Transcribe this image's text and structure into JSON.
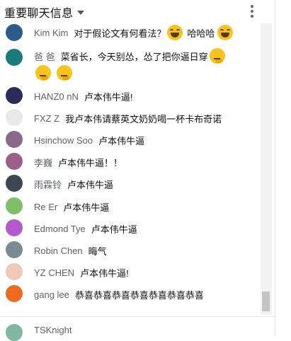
{
  "header": {
    "title": "重要聊天信息"
  },
  "messages": [
    {
      "name": "Kim Kim",
      "text": "对于假论文有何看法？",
      "after": "哈哈哈",
      "avatar_color": "#2b5d8c"
    },
    {
      "name": "爸 爸",
      "text": "菜省长，今天别怂，怂了把你逼日穿",
      "avatar_color": "#1b7a7a"
    },
    {
      "name": "HANZ0 nN",
      "text": "卢本伟牛逼!",
      "avatar_color": "#2a2d5c"
    },
    {
      "name": "FXZ Z",
      "text": "我卢本伟请蔡英文奶奶喝一杯卡布奇诺",
      "avatar_color": "#e9e9e9"
    },
    {
      "name": "Hsinchow Soo",
      "text": "卢本伟牛逼",
      "avatar_color": "#8a6a8a"
    },
    {
      "name": "李巍",
      "text": "卢本伟牛逼！！",
      "avatar_color": "#9c5f88"
    },
    {
      "name": "雨霖铃",
      "text": "卢本伟牛逼",
      "avatar_color": "#3d4651"
    },
    {
      "name": "Re Er",
      "text": "卢本伟牛逼",
      "avatar_color": "#7fbf6a"
    },
    {
      "name": "Edmond Tye",
      "text": "卢本伟牛逼",
      "avatar_color": "#b25acb"
    },
    {
      "name": "Robin Chen",
      "text": "晦气",
      "avatar_color": "#7a8c92"
    },
    {
      "name": "YZ CHEN",
      "text": "卢本伟牛逼!",
      "avatar_color": "#f2c9b8"
    },
    {
      "name": "gang lee",
      "text": "恭喜恭喜恭喜恭喜恭喜恭喜恭喜",
      "avatar_color": "#ee6b1e"
    }
  ],
  "footer": {
    "name": "TSKnight",
    "avatar_color": "#7fb8a0"
  },
  "icons": {
    "menu": "kebab-menu-icon",
    "caret": "caret-down-icon",
    "emoji_laugh": "laughing-emoji-icon",
    "emoji_think": "thinking-emoji-icon"
  }
}
